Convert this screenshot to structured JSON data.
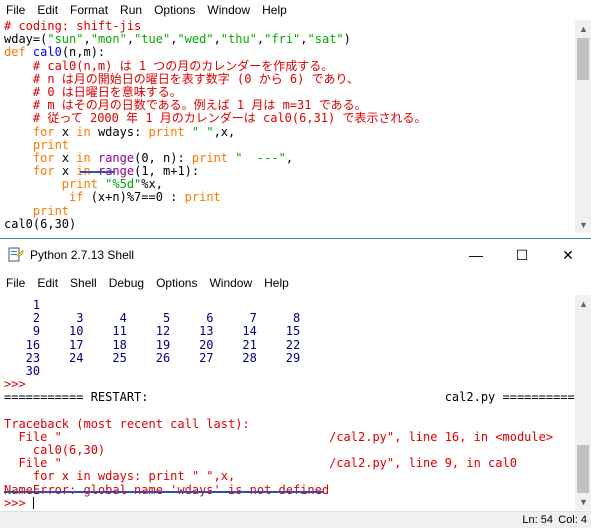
{
  "editor_menu": [
    "File",
    "Edit",
    "Format",
    "Run",
    "Options",
    "Window",
    "Help"
  ],
  "editor_lines": [
    [
      {
        "t": "# coding: shift-jis",
        "c": "red"
      }
    ],
    [
      {
        "t": "wday=(",
        "c": "black"
      },
      {
        "t": "\"sun\"",
        "c": "green"
      },
      {
        "t": ",",
        "c": "black"
      },
      {
        "t": "\"mon\"",
        "c": "green"
      },
      {
        "t": ",",
        "c": "black"
      },
      {
        "t": "\"tue\"",
        "c": "green"
      },
      {
        "t": ",",
        "c": "black"
      },
      {
        "t": "\"wed\"",
        "c": "green"
      },
      {
        "t": ",",
        "c": "black"
      },
      {
        "t": "\"thu\"",
        "c": "green"
      },
      {
        "t": ",",
        "c": "black"
      },
      {
        "t": "\"fri\"",
        "c": "green"
      },
      {
        "t": ",",
        "c": "black"
      },
      {
        "t": "\"sat\"",
        "c": "green"
      },
      {
        "t": ")",
        "c": "black"
      }
    ],
    [
      {
        "t": "def ",
        "c": "orange"
      },
      {
        "t": "cal0",
        "c": "blue"
      },
      {
        "t": "(n,m):",
        "c": "black"
      }
    ],
    [
      {
        "t": "    # cal0(n,m) は 1 つの月のカレンダーを作成する。",
        "c": "red"
      }
    ],
    [
      {
        "t": "    # n は月の開始日の曜日を表す数字 (0 から 6) であり、",
        "c": "red"
      }
    ],
    [
      {
        "t": "    # 0 は日曜日を意味する。",
        "c": "red"
      }
    ],
    [
      {
        "t": "    # m はその月の日数である。例えば 1 月は m=31 である。",
        "c": "red"
      }
    ],
    [
      {
        "t": "    # 従って 2000 年 1 月のカレンダーは cal0(6,31) で表示される。",
        "c": "red"
      }
    ],
    [
      {
        "t": "    ",
        "c": "black"
      },
      {
        "t": "for",
        "c": "orange"
      },
      {
        "t": " x ",
        "c": "black"
      },
      {
        "t": "in",
        "c": "orange"
      },
      {
        "t": " wdays: ",
        "c": "black"
      },
      {
        "t": "print",
        "c": "orange"
      },
      {
        "t": " ",
        "c": "black"
      },
      {
        "t": "\" \"",
        "c": "green"
      },
      {
        "t": ",x,",
        "c": "black"
      }
    ],
    [
      {
        "t": "    ",
        "c": "black"
      },
      {
        "t": "print",
        "c": "orange"
      }
    ],
    [
      {
        "t": "    ",
        "c": "black"
      },
      {
        "t": "for",
        "c": "orange"
      },
      {
        "t": " x ",
        "c": "black"
      },
      {
        "t": "in",
        "c": "orange"
      },
      {
        "t": " ",
        "c": "black"
      },
      {
        "t": "range",
        "c": "purple"
      },
      {
        "t": "(0, n): ",
        "c": "black"
      },
      {
        "t": "print",
        "c": "orange"
      },
      {
        "t": " ",
        "c": "black"
      },
      {
        "t": "\"  ---\"",
        "c": "green"
      },
      {
        "t": ",",
        "c": "black"
      }
    ],
    [
      {
        "t": "    ",
        "c": "black"
      },
      {
        "t": "for",
        "c": "orange"
      },
      {
        "t": " x ",
        "c": "black"
      },
      {
        "t": "in",
        "c": "orange"
      },
      {
        "t": " ",
        "c": "black"
      },
      {
        "t": "range",
        "c": "purple"
      },
      {
        "t": "(1, m+1):",
        "c": "black"
      }
    ],
    [
      {
        "t": "        ",
        "c": "black"
      },
      {
        "t": "print",
        "c": "orange"
      },
      {
        "t": " ",
        "c": "black"
      },
      {
        "t": "\"%5d\"",
        "c": "green"
      },
      {
        "t": "%x,",
        "c": "black"
      }
    ],
    [
      {
        "t": "         ",
        "c": "black"
      },
      {
        "t": "if",
        "c": "orange"
      },
      {
        "t": " (x+n)%7==0 : ",
        "c": "black"
      },
      {
        "t": "print",
        "c": "orange"
      }
    ],
    [
      {
        "t": "    ",
        "c": "black"
      },
      {
        "t": "print",
        "c": "orange"
      }
    ],
    [
      {
        "t": "cal0(6,30)",
        "c": "black"
      }
    ]
  ],
  "shell_title": "Python 2.7.13 Shell",
  "shell_menu": [
    "File",
    "Edit",
    "Shell",
    "Debug",
    "Options",
    "Window",
    "Help"
  ],
  "shell_lines": [
    [
      {
        "t": "    1",
        "c": "shellblue"
      }
    ],
    [
      {
        "t": "    2     3     4     5     6     7     8",
        "c": "shellblue"
      }
    ],
    [
      {
        "t": "    9    10    11    12    13    14    15",
        "c": "shellblue"
      }
    ],
    [
      {
        "t": "   16    17    18    19    20    21    22",
        "c": "shellblue"
      }
    ],
    [
      {
        "t": "   23    24    25    26    27    28    29",
        "c": "shellblue"
      }
    ],
    [
      {
        "t": "   30",
        "c": "shellblue"
      }
    ],
    [
      {
        "t": ">>>",
        "c": "red"
      }
    ],
    [
      {
        "t": "=========== RESTART:                                         cal2.py ===========",
        "c": "black"
      }
    ],
    [
      {
        "t": "",
        "c": "black"
      }
    ],
    [
      {
        "t": "Traceback (most recent call last):",
        "c": "red"
      }
    ],
    [
      {
        "t": "  File \"                                     /cal2.py\", line 16, in <module>",
        "c": "red"
      }
    ],
    [
      {
        "t": "    cal0(6,30)",
        "c": "red"
      }
    ],
    [
      {
        "t": "  File \"                                     /cal2.py\", line 9, in cal0",
        "c": "red"
      }
    ],
    [
      {
        "t": "    for x in wdays: print \" \",x,",
        "c": "red"
      }
    ],
    [
      {
        "t": "NameError: global name 'wdays' is not defined",
        "c": "red"
      }
    ],
    [
      {
        "t": ">>> ",
        "c": "red"
      }
    ]
  ],
  "status": {
    "line": "Ln: 54",
    "col": "Col: 4"
  },
  "window_buttons": {
    "minimize": "—",
    "maximize": "☐",
    "close": "✕"
  }
}
